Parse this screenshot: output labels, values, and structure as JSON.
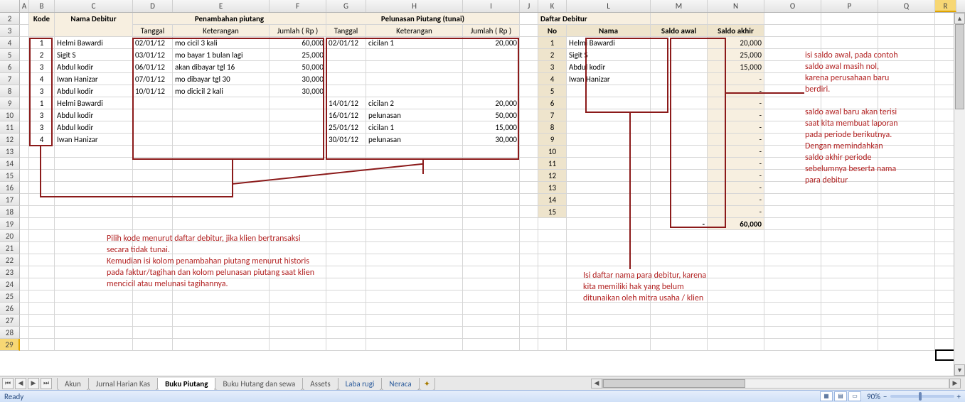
{
  "columns": [
    "A",
    "B",
    "C",
    "D",
    "E",
    "F",
    "G",
    "H",
    "I",
    "J",
    "K",
    "L",
    "M",
    "N",
    "O",
    "P",
    "Q",
    "R"
  ],
  "row_numbers": [
    2,
    3,
    4,
    5,
    6,
    7,
    8,
    9,
    10,
    11,
    12,
    13,
    14,
    15,
    16,
    17,
    18,
    19,
    20,
    21,
    22,
    23,
    24,
    25,
    26,
    27,
    28,
    29
  ],
  "headers": {
    "kode": "Kode",
    "nama_debitur": "Nama Debitur",
    "penambahan": "Penambahan piutang",
    "pelunasan": "Pelunasan Piutang (tunai)",
    "tanggal": "Tanggal",
    "keterangan": "Keterangan",
    "jumlah": "Jumlah ( Rp )",
    "daftar_debitur": "Daftar Debitur",
    "no": "No",
    "nama": "Nama",
    "saldo_awal": "Saldo awal",
    "saldo_akhir": "Saldo akhir"
  },
  "piutang_rows": [
    {
      "kode": "1",
      "nama": "Helmi Bawardi",
      "ptgl": "02/01/12",
      "pket": "mo cicil 3 kali",
      "pjml": "60,000",
      "ltgl": "02/01/12",
      "lket": "cicilan 1",
      "ljml": "20,000"
    },
    {
      "kode": "2",
      "nama": "Sigit S",
      "ptgl": "03/01/12",
      "pket": "mo bayar 1 bulan lagi",
      "pjml": "25,000",
      "ltgl": "",
      "lket": "",
      "ljml": ""
    },
    {
      "kode": "3",
      "nama": "Abdul kodir",
      "ptgl": "06/01/12",
      "pket": "akan dibayar tgl 16",
      "pjml": "50,000",
      "ltgl": "",
      "lket": "",
      "ljml": ""
    },
    {
      "kode": "4",
      "nama": "Iwan Hanizar",
      "ptgl": "07/01/12",
      "pket": "mo dibayar tgl 30",
      "pjml": "30,000",
      "ltgl": "",
      "lket": "",
      "ljml": ""
    },
    {
      "kode": "3",
      "nama": "Abdul kodir",
      "ptgl": "10/01/12",
      "pket": "mo dicicil 2 kali",
      "pjml": "30,000",
      "ltgl": "",
      "lket": "",
      "ljml": ""
    },
    {
      "kode": "1",
      "nama": "Helmi Bawardi",
      "ptgl": "",
      "pket": "",
      "pjml": "",
      "ltgl": "14/01/12",
      "lket": "cicilan 2",
      "ljml": "20,000"
    },
    {
      "kode": "3",
      "nama": "Abdul kodir",
      "ptgl": "",
      "pket": "",
      "pjml": "",
      "ltgl": "16/01/12",
      "lket": "pelunasan",
      "ljml": "50,000"
    },
    {
      "kode": "3",
      "nama": "Abdul kodir",
      "ptgl": "",
      "pket": "",
      "pjml": "",
      "ltgl": "25/01/12",
      "lket": "cicilan 1",
      "ljml": "15,000"
    },
    {
      "kode": "4",
      "nama": "Iwan Hanizar",
      "ptgl": "",
      "pket": "",
      "pjml": "",
      "ltgl": "30/01/12",
      "lket": "pelunasan",
      "ljml": "30,000"
    }
  ],
  "daftar": [
    {
      "no": "1",
      "nama": "Helmi Bawardi",
      "awal": "",
      "akhir": "20,000"
    },
    {
      "no": "2",
      "nama": "Sigit S",
      "awal": "",
      "akhir": "25,000"
    },
    {
      "no": "3",
      "nama": "Abdul kodir",
      "awal": "",
      "akhir": "15,000"
    },
    {
      "no": "4",
      "nama": "Iwan Hanizar",
      "awal": "",
      "akhir": "-"
    },
    {
      "no": "5",
      "nama": "",
      "awal": "",
      "akhir": "-"
    },
    {
      "no": "6",
      "nama": "",
      "awal": "",
      "akhir": "-"
    },
    {
      "no": "7",
      "nama": "",
      "awal": "",
      "akhir": "-"
    },
    {
      "no": "8",
      "nama": "",
      "awal": "",
      "akhir": "-"
    },
    {
      "no": "9",
      "nama": "",
      "awal": "",
      "akhir": "-"
    },
    {
      "no": "10",
      "nama": "",
      "awal": "",
      "akhir": "-"
    },
    {
      "no": "11",
      "nama": "",
      "awal": "",
      "akhir": "-"
    },
    {
      "no": "12",
      "nama": "",
      "awal": "",
      "akhir": "-"
    },
    {
      "no": "13",
      "nama": "",
      "awal": "",
      "akhir": "-"
    },
    {
      "no": "14",
      "nama": "",
      "awal": "",
      "akhir": "-"
    },
    {
      "no": "15",
      "nama": "",
      "awal": "",
      "akhir": "-"
    }
  ],
  "totals": {
    "awal": "-",
    "akhir": "60,000"
  },
  "annotations": {
    "left_block": "Pilih kode menurut daftar debitur, jika klien bertransaksi\nsecara tidak tunai.\nKemudian isi kolom penambahan piutang menurut historis\npada faktur/tagihan dan kolom pelunasan piutang saat klien\nmencicil atau melunasi tagihannya.",
    "mid_block": "Isi daftar nama para debitur, karena\nkita memiliki hak yang belum\nditunaikan oleh mitra usaha / klien",
    "right_block": "isi saldo awal, pada contoh\nsaldo awal masih nol,\nkarena perusahaan baru\nberdiri.\n\nsaldo awal baru akan terisi\nsaat kita membuat laporan\npada periode berikutnya.\nDengan memindahkan\nsaldo akhir periode\nsebelumnya beserta nama\npara debitur"
  },
  "tabs": {
    "list": [
      "Akun",
      "Jurnal Harian Kas",
      "Buku Piutang",
      "Buku Hutang dan sewa",
      "Assets",
      "Laba rugi",
      "Neraca"
    ],
    "active": "Buku Piutang",
    "blue": [
      "Laba rugi",
      "Neraca"
    ]
  },
  "status": {
    "ready": "Ready",
    "zoom": "90%"
  }
}
